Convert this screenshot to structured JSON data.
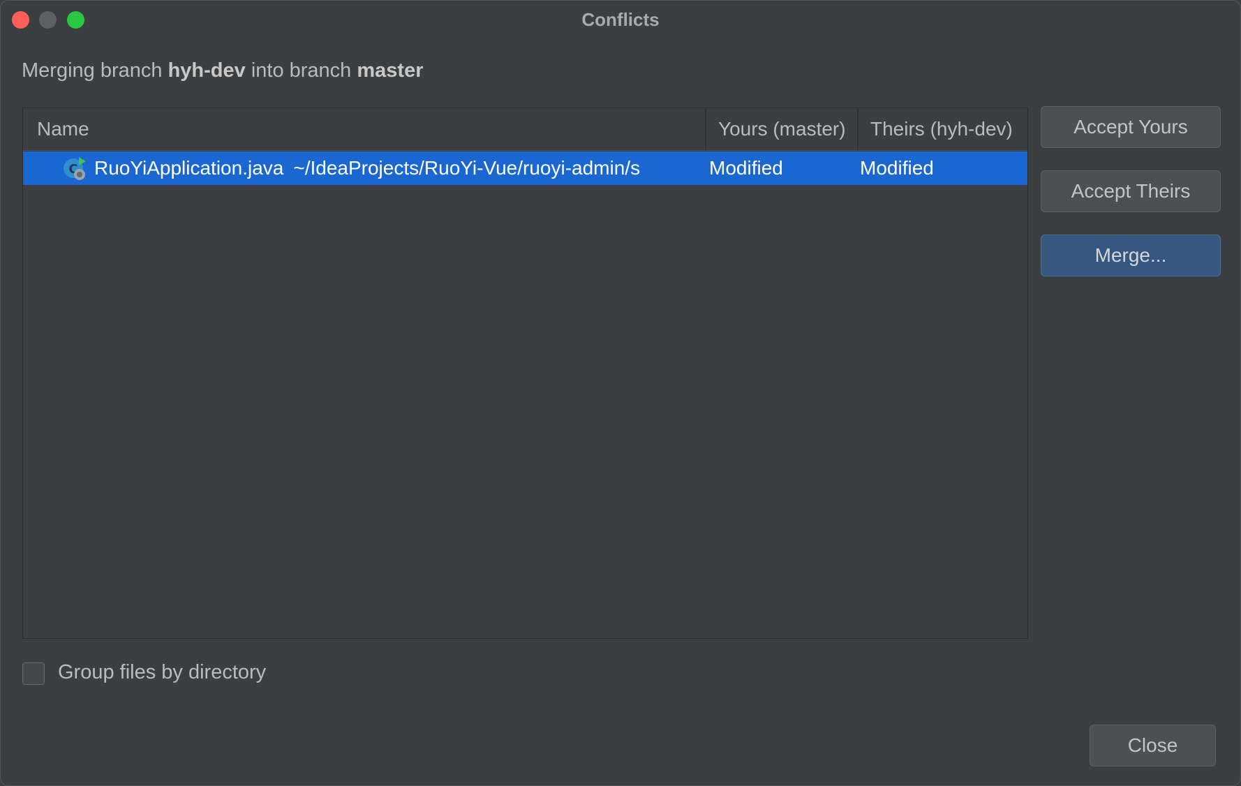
{
  "window": {
    "title": "Conflicts",
    "controls": [
      "close",
      "minimize",
      "maximize"
    ]
  },
  "merge_info": {
    "prefix": "Merging branch",
    "source_branch": "hyh-dev",
    "middle": "into branch",
    "target_branch": "master"
  },
  "table": {
    "headers": {
      "name": "Name",
      "yours": "Yours (master)",
      "theirs": "Theirs (hyh-dev)"
    },
    "rows": [
      {
        "icon": "java-class-conflict-icon",
        "file": "RuoYiApplication.java",
        "path": "~/IdeaProjects/RuoYi-Vue/ruoyi-admin/s",
        "yours": "Modified",
        "theirs": "Modified",
        "selected": true
      }
    ]
  },
  "buttons": {
    "accept_yours": "Accept Yours",
    "accept_theirs": "Accept Theirs",
    "merge": "Merge...",
    "close": "Close"
  },
  "options": {
    "group_by_directory_label": "Group files by directory",
    "group_by_directory_checked": false
  },
  "colors": {
    "background": "#3c3f41",
    "selection": "#1a67d1",
    "default_button": "#365880"
  }
}
